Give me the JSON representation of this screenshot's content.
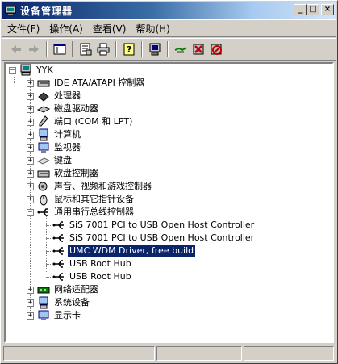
{
  "window": {
    "title": "设备管理器"
  },
  "menu": [
    {
      "label": "文件(F)"
    },
    {
      "label": "操作(A)"
    },
    {
      "label": "查看(V)"
    },
    {
      "label": "帮助(H)"
    }
  ],
  "title_buttons": {
    "minimize": "_",
    "maximize": "□",
    "close": "×"
  },
  "tree": {
    "root": "YYK",
    "categories": [
      {
        "label": "IDE ATA/ATAPI 控制器",
        "icon": "ide-controller-icon"
      },
      {
        "label": "处理器",
        "icon": "processor-icon"
      },
      {
        "label": "磁盘驱动器",
        "icon": "disk-drive-icon"
      },
      {
        "label": "端口 (COM 和 LPT)",
        "icon": "port-icon"
      },
      {
        "label": "计算机",
        "icon": "computer-icon"
      },
      {
        "label": "监视器",
        "icon": "monitor-icon"
      },
      {
        "label": "键盘",
        "icon": "keyboard-icon"
      },
      {
        "label": "软盘控制器",
        "icon": "floppy-controller-icon"
      },
      {
        "label": "声音、视频和游戏控制器",
        "icon": "sound-icon"
      },
      {
        "label": "鼠标和其它指针设备",
        "icon": "mouse-icon"
      },
      {
        "label": "通用串行总线控制器",
        "icon": "usb-icon"
      }
    ],
    "usb_children": [
      {
        "label": "SiS 7001 PCI to USB Open Host Controller"
      },
      {
        "label": "SiS 7001 PCI to USB Open Host Controller"
      },
      {
        "label": "UMC WDM Driver, free build"
      },
      {
        "label": "USB Root Hub"
      },
      {
        "label": "USB Root Hub"
      }
    ],
    "after": [
      {
        "label": "网络适配器",
        "icon": "network-adapter-icon"
      },
      {
        "label": "系统设备",
        "icon": "system-device-icon"
      },
      {
        "label": "显示卡",
        "icon": "display-adapter-icon"
      }
    ]
  },
  "colors": {
    "selection": "#0a246a",
    "title_start": "#0a246a",
    "face": "#d4d0c8"
  }
}
